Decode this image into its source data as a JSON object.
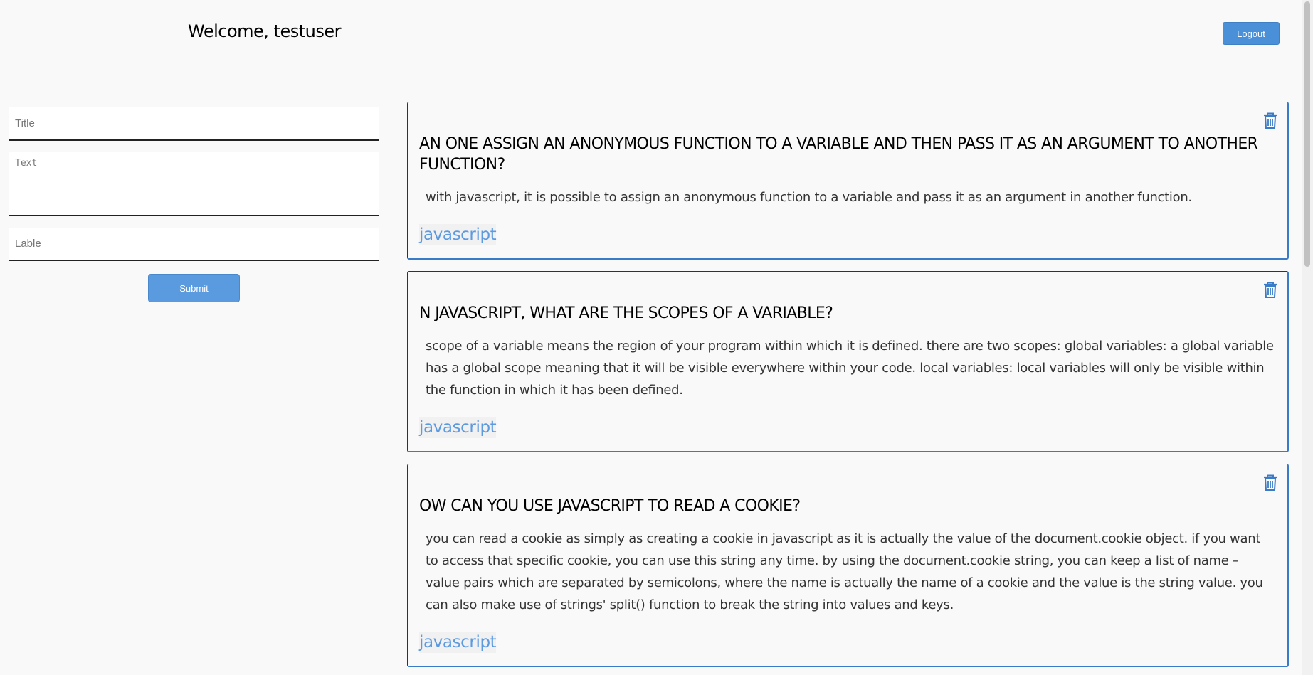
{
  "header": {
    "welcome": "Welcome, testuser",
    "logout_label": "Logout"
  },
  "form": {
    "title_placeholder": "Title",
    "text_placeholder": "Text",
    "label_placeholder": "Lable",
    "submit_label": "Submit"
  },
  "cards": [
    {
      "title": "AN ONE ASSIGN AN ANONYMOUS FUNCTION TO A VARIABLE AND THEN PASS IT AS AN ARGUMENT TO ANOTHER FUNCTION?",
      "text": "with javascript, it is possible to assign an anonymous function to a variable and pass it as an argument in another function.",
      "label": "javascript",
      "delete_icon": "trash-icon"
    },
    {
      "title": "N JAVASCRIPT, WHAT ARE THE SCOPES OF A VARIABLE?",
      "text": "scope of a variable means the region of your program within which it is defined. there are two scopes: global variables: a global variable has a global scope meaning that it will be visible everywhere within your code. local variables: local variables will only be visible within the function in which it has been defined.",
      "label": "javascript",
      "delete_icon": "trash-icon"
    },
    {
      "title": "OW CAN YOU USE JAVASCRIPT TO READ A COOKIE?",
      "text": "you can read a cookie as simply as creating a cookie in javascript as it is actually the value of the document.cookie object. if you want to access that specific cookie, you can use this string any time. by using the document.cookie string, you can keep a list of name – value pairs which are separated by semicolons, where the name is actually the name of a cookie and the value is the string value. you can also make use of strings' split() function to break the string into values and keys.",
      "label": "javascript",
      "delete_icon": "trash-icon"
    }
  ],
  "colors": {
    "accent": "#4a90d9",
    "label": "#5c9ae0",
    "background": "#f9f9f9"
  }
}
